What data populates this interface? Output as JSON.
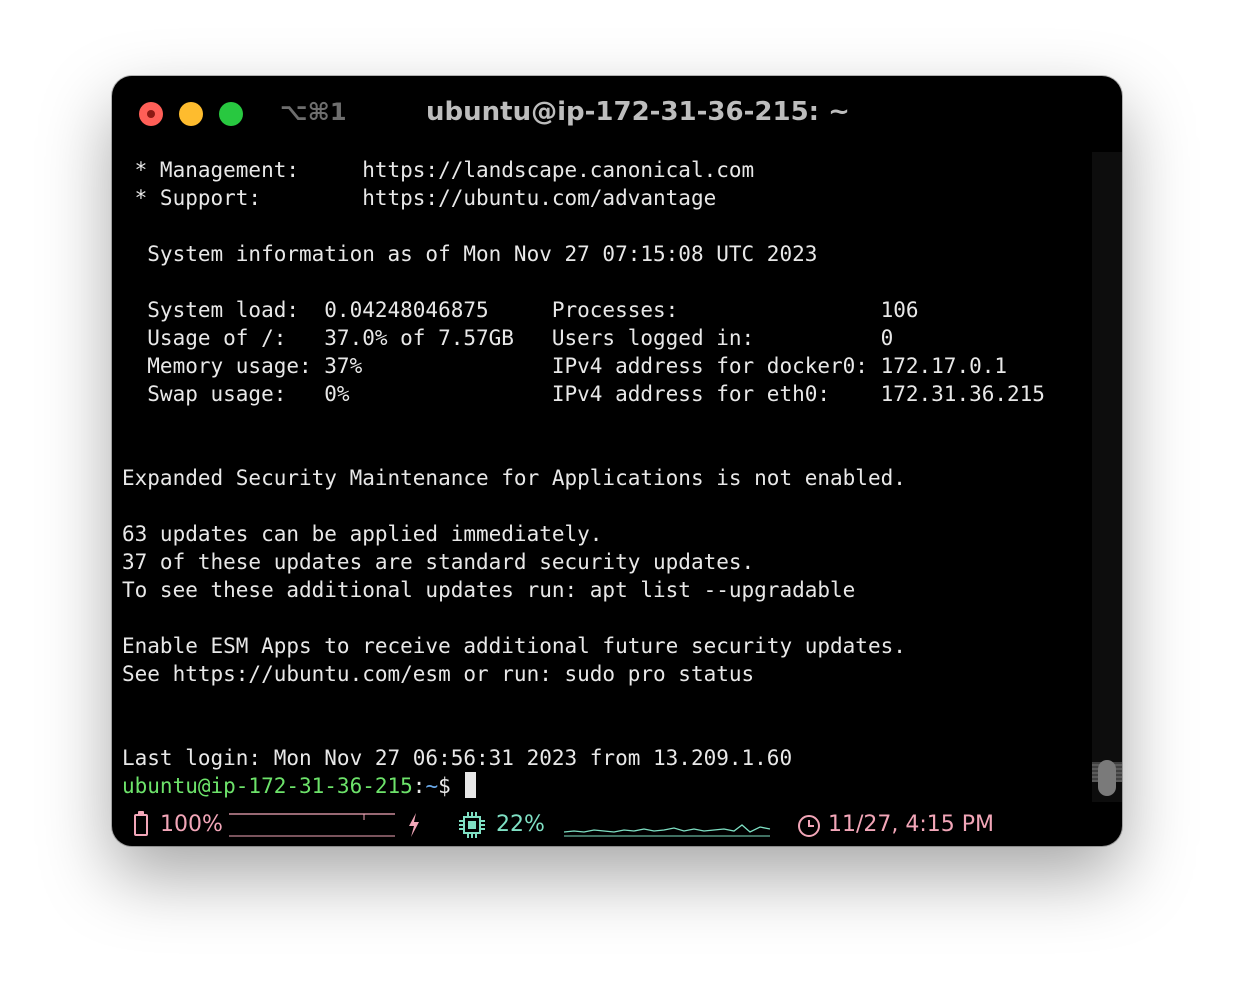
{
  "window": {
    "title": "ubuntu@ip-172-31-36-215: ~",
    "tab_shortcut": "⌥⌘1"
  },
  "terminal": {
    "lines": [
      " * Management:     https://landscape.canonical.com",
      " * Support:        https://ubuntu.com/advantage",
      "",
      "  System information as of Mon Nov 27 07:15:08 UTC 2023",
      "",
      "  System load:  0.04248046875     Processes:                106",
      "  Usage of /:   37.0% of 7.57GB   Users logged in:          0",
      "  Memory usage: 37%               IPv4 address for docker0: 172.17.0.1",
      "  Swap usage:   0%                IPv4 address for eth0:    172.31.36.215",
      "",
      "",
      "Expanded Security Maintenance for Applications is not enabled.",
      "",
      "63 updates can be applied immediately.",
      "37 of these updates are standard security updates.",
      "To see these additional updates run: apt list --upgradable",
      "",
      "Enable ESM Apps to receive additional future security updates.",
      "See https://ubuntu.com/esm or run: sudo pro status",
      "",
      "",
      "Last login: Mon Nov 27 06:56:31 2023 from 13.209.1.60"
    ],
    "prompt": {
      "user_host": "ubuntu@ip-172-31-36-215",
      "separator": ":",
      "path": "~",
      "symbol": "$ "
    }
  },
  "statusbar": {
    "battery": "100%",
    "cpu": "22%",
    "datetime": "11/27, 4:15 PM",
    "colors": {
      "battery": "#f2a6b8",
      "cpu": "#7fe0c4"
    },
    "icons": [
      "battery-icon",
      "lightning-icon",
      "cpu-chip-icon",
      "clock-icon"
    ]
  }
}
